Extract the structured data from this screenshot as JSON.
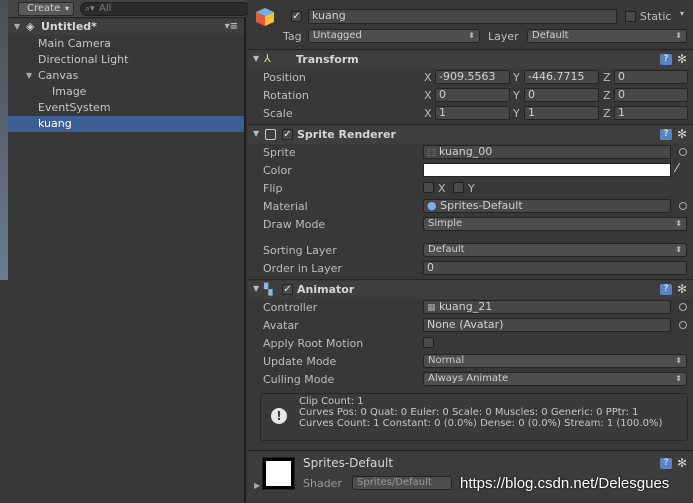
{
  "hierarchy": {
    "create_label": "Create",
    "search_placeholder": "All",
    "scene_name": "Untitled*",
    "items": [
      {
        "label": "Main Camera"
      },
      {
        "label": "Directional Light"
      },
      {
        "label": "Canvas"
      },
      {
        "label": "Image"
      },
      {
        "label": "EventSystem"
      },
      {
        "label": "kuang"
      }
    ]
  },
  "inspector": {
    "object_name": "kuang",
    "static_label": "Static",
    "tag_label": "Tag",
    "tag_value": "Untagged",
    "layer_label": "Layer",
    "layer_value": "Default",
    "transform": {
      "title": "Transform",
      "position_label": "Position",
      "rotation_label": "Rotation",
      "scale_label": "Scale",
      "axis_x": "X",
      "axis_y": "Y",
      "axis_z": "Z",
      "position": {
        "x": "-909.5563",
        "y": "-446.7715",
        "z": "0"
      },
      "rotation": {
        "x": "0",
        "y": "0",
        "z": "0"
      },
      "scale": {
        "x": "1",
        "y": "1",
        "z": "1"
      }
    },
    "sprite_renderer": {
      "title": "Sprite Renderer",
      "sprite_label": "Sprite",
      "sprite_value": "kuang_00",
      "color_label": "Color",
      "flip_label": "Flip",
      "flip_x": "X",
      "flip_y": "Y",
      "material_label": "Material",
      "material_value": "Sprites-Default",
      "draw_mode_label": "Draw Mode",
      "draw_mode_value": "Simple",
      "sorting_layer_label": "Sorting Layer",
      "sorting_layer_value": "Default",
      "order_label": "Order in Layer",
      "order_value": "0"
    },
    "animator": {
      "title": "Animator",
      "controller_label": "Controller",
      "controller_value": "kuang_21",
      "avatar_label": "Avatar",
      "avatar_value": "None (Avatar)",
      "root_motion_label": "Apply Root Motion",
      "update_mode_label": "Update Mode",
      "update_mode_value": "Normal",
      "culling_mode_label": "Culling Mode",
      "culling_mode_value": "Always Animate",
      "info": [
        "Clip Count: 1",
        "Curves Pos: 0 Quat: 0 Euler: 0 Scale: 0 Muscles: 0 Generic: 0 PPtr: 1",
        "Curves Count: 1 Constant: 0 (0.0%) Dense: 0 (0.0%) Stream: 1 (100.0%)"
      ]
    },
    "material": {
      "name": "Sprites-Default",
      "shader_label": "Shader",
      "shader_value": "Sprites/Default"
    }
  },
  "watermark": "https://blog.csdn.net/Delesgues",
  "colors": {
    "selection": "#3e5f96",
    "panel": "#383838",
    "help_blue": "#5a83c2"
  }
}
